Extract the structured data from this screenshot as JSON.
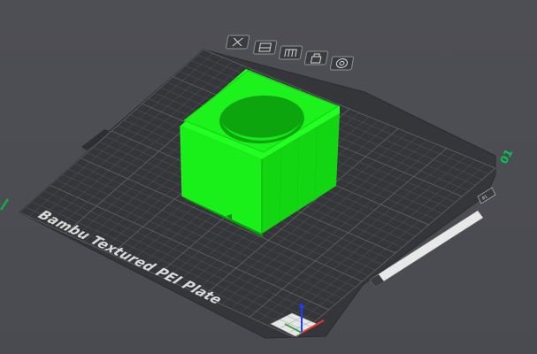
{
  "viewport": {
    "background": "#4b4c51",
    "plate_color": "#36373b",
    "grid_color": "#5a5b60",
    "object_color": "#19ff19",
    "object_shadow": "#0bb40b"
  },
  "plate": {
    "brand_text": "Bambu Textured PEI Plate",
    "plate_number": "01",
    "corner_tag": "01",
    "label_strip": "",
    "buttons": [
      {
        "name": "delete-plate-icon",
        "label": "delete plate"
      },
      {
        "name": "arrange-icon",
        "label": "arrange"
      },
      {
        "name": "orient-icon",
        "label": "orient"
      },
      {
        "name": "lock-icon",
        "label": "lock"
      },
      {
        "name": "settings-icon",
        "label": "settings"
      }
    ]
  },
  "axes": {
    "x_color": "#e53935",
    "y_color": "#43a047",
    "z_color": "#1e3cff"
  }
}
